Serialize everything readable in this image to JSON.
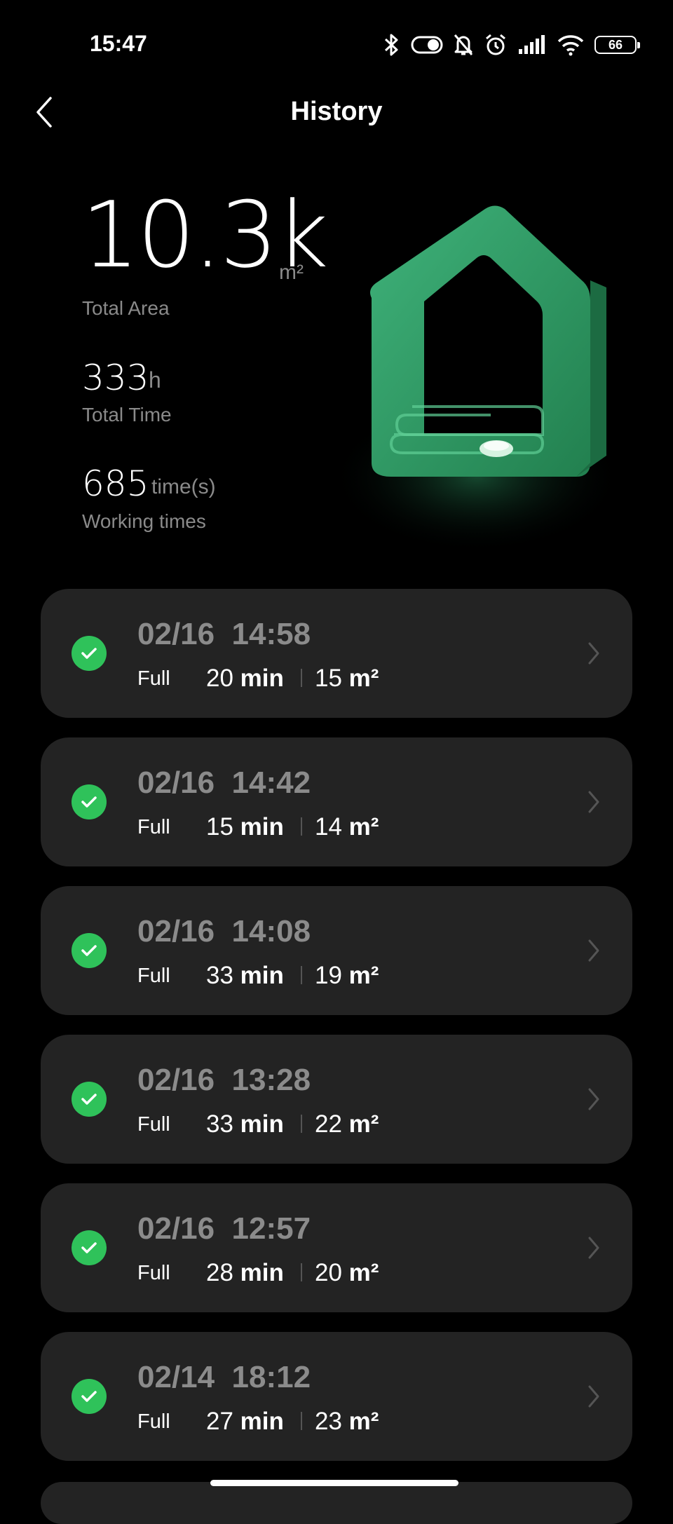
{
  "status_bar": {
    "time": "15:47",
    "battery": "66",
    "icons": [
      "bluetooth-icon",
      "toggle-icon",
      "bell-muted-icon",
      "alarm-icon",
      "signal-icon",
      "wifi-icon",
      "battery-icon"
    ]
  },
  "header": {
    "title": "History",
    "back_icon": "chevron-left-icon"
  },
  "stats": {
    "area_value": "10.3k",
    "area_unit": "m²",
    "area_label": "Total Area",
    "time_value": "333",
    "time_unit": "h",
    "time_label": "Total Time",
    "count_value": "685",
    "count_unit": "time(s)",
    "count_label": "Working times"
  },
  "colors": {
    "background": "#000000",
    "card": "#232323",
    "success": "#2fc25a",
    "illustration": "#2e9a63",
    "muted_text": "#8b8b8b"
  },
  "history": [
    {
      "datetime": "02/16  14:58",
      "mode": "Full",
      "duration": "20",
      "duration_unit": "min",
      "area": "15",
      "area_unit": "m²"
    },
    {
      "datetime": "02/16  14:42",
      "mode": "Full",
      "duration": "15",
      "duration_unit": "min",
      "area": "14",
      "area_unit": "m²"
    },
    {
      "datetime": "02/16  14:08",
      "mode": "Full",
      "duration": "33",
      "duration_unit": "min",
      "area": "19",
      "area_unit": "m²"
    },
    {
      "datetime": "02/16  13:28",
      "mode": "Full",
      "duration": "33",
      "duration_unit": "min",
      "area": "22",
      "area_unit": "m²"
    },
    {
      "datetime": "02/16  12:57",
      "mode": "Full",
      "duration": "28",
      "duration_unit": "min",
      "area": "20",
      "area_unit": "m²"
    },
    {
      "datetime": "02/14  18:12",
      "mode": "Full",
      "duration": "27",
      "duration_unit": "min",
      "area": "23",
      "area_unit": "m²"
    }
  ]
}
